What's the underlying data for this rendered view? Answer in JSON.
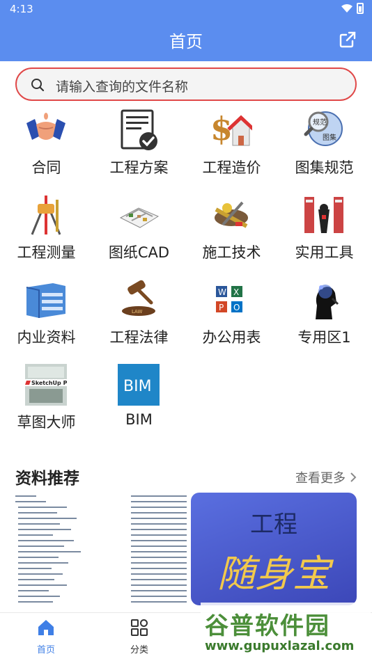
{
  "status_bar": {
    "time": "4:13"
  },
  "header": {
    "title": "首页"
  },
  "search": {
    "placeholder": "请输入查询的文件名称"
  },
  "categories": [
    {
      "label": "合同",
      "icon": "handshake-icon"
    },
    {
      "label": "工程方案",
      "icon": "document-check-icon"
    },
    {
      "label": "工程造价",
      "icon": "money-house-icon"
    },
    {
      "label": "图集规范",
      "icon": "atlas-magnifier-icon"
    },
    {
      "label": "工程测量",
      "icon": "survey-tripod-icon"
    },
    {
      "label": "图纸CAD",
      "icon": "floorplan-icon"
    },
    {
      "label": "施工技术",
      "icon": "construction-tools-icon"
    },
    {
      "label": "实用工具",
      "icon": "books-icon"
    },
    {
      "label": "内业资料",
      "icon": "binders-icon"
    },
    {
      "label": "工程法律",
      "icon": "gavel-icon"
    },
    {
      "label": "办公用表",
      "icon": "office-apps-icon"
    },
    {
      "label": "专用区1",
      "icon": "thinking-person-icon"
    },
    {
      "label": "草图大师",
      "icon": "sketchup-icon"
    },
    {
      "label": "BIM",
      "icon": "bim-icon",
      "badge": "BIM"
    }
  ],
  "recommend": {
    "title": "资料推荐",
    "more": "查看更多",
    "promo_top": "工程",
    "promo_main": "随身宝"
  },
  "bottom_nav": [
    {
      "label": "首页",
      "icon": "home-icon",
      "active": true
    },
    {
      "label": "分类",
      "icon": "category-grid-icon",
      "active": false
    }
  ],
  "watermark": {
    "text": "谷普软件园",
    "url": "www.gupuxlazal.com"
  },
  "colors": {
    "primary": "#5b8def",
    "search_border": "#e04848",
    "nav_active": "#3f7fe6"
  }
}
